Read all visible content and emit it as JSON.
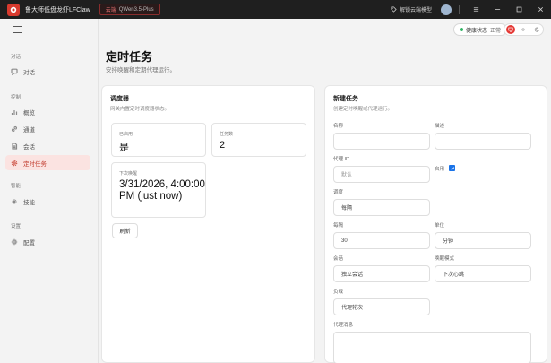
{
  "titlebar": {
    "app_title": "鲁大师低盘龙虾LFClaw",
    "model_badge_prefix": "云端",
    "model_name": "QWen3.5-Plus",
    "unlock_label": "解锁云端模型"
  },
  "sidebar": {
    "groups": [
      {
        "label": "对话",
        "items": [
          {
            "label": "对话",
            "icon": "chat-icon"
          }
        ]
      },
      {
        "label": "控制",
        "items": [
          {
            "label": "概览",
            "icon": "chart-icon"
          },
          {
            "label": "通道",
            "icon": "link-icon"
          },
          {
            "label": "会话",
            "icon": "document-icon"
          },
          {
            "label": "定时任务",
            "icon": "gear-icon",
            "active": true
          }
        ]
      },
      {
        "label": "智能",
        "items": [
          {
            "label": "技能",
            "icon": "sparkle-icon"
          }
        ]
      },
      {
        "label": "设置",
        "items": [
          {
            "label": "配置",
            "icon": "settings-icon"
          }
        ]
      }
    ]
  },
  "header": {
    "title": "定时任务",
    "subtitle": "安排唤醒和定期代理运行。",
    "health_label": "健康状态",
    "health_value": "正常"
  },
  "scheduler": {
    "title": "调度器",
    "subtitle": "网关内置定时调度器状态。",
    "enabled_label": "已启用",
    "enabled_value": "是",
    "task_count_label": "任务数",
    "task_count_value": "2",
    "next_wake_label": "下次唤醒",
    "next_wake_value": "3/31/2026, 4:00:00 PM (just now)",
    "refresh_label": "刷新"
  },
  "new_task": {
    "title": "新建任务",
    "subtitle": "创建定时唤醒或代理运行。",
    "name_label": "名称",
    "name_value": "",
    "description_label": "描述",
    "description_value": "",
    "agent_id_label": "代理 ID",
    "agent_id_placeholder": "默认",
    "enabled_label": "启用",
    "schedule_label": "调度",
    "schedule_value": "每隔",
    "every_label": "每隔",
    "every_value": "30",
    "unit_label": "单位",
    "unit_value": "分钟",
    "session_label": "会话",
    "session_value": "独立会话",
    "wake_mode_label": "唤醒模式",
    "wake_mode_value": "下次心跳",
    "payload_label": "负载",
    "payload_value": "代理轮次",
    "agent_message_label": "代理消息"
  }
}
